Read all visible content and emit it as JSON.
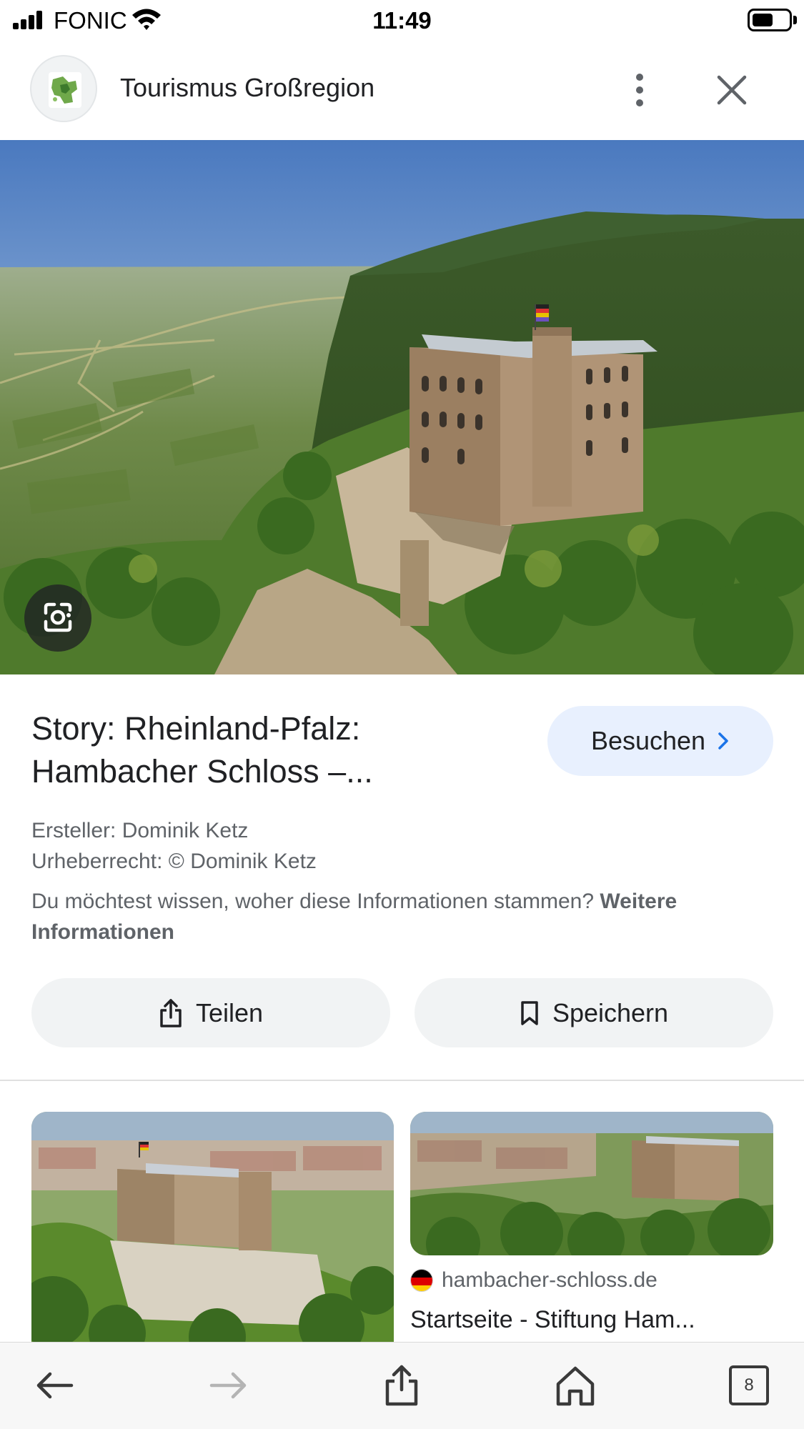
{
  "status_bar": {
    "carrier": "FONIC",
    "time": "11:49",
    "signal_icon": "cellular-signal-icon",
    "wifi_icon": "wifi-icon",
    "battery_icon": "battery-icon",
    "battery_level": 0.55
  },
  "header": {
    "title": "Tourismus Großregion",
    "logo": "site-logo",
    "more_icon": "more-vert-icon",
    "close_icon": "close-icon"
  },
  "hero": {
    "image": "aerial-view-castle-vineyards",
    "lens_icon": "google-lens-icon"
  },
  "story": {
    "title_line1": "Story: Rheinland-Pfalz:",
    "title_line2": "Hambacher Schloss –...",
    "visit_label": "Besuchen",
    "visit_icon": "chevron-right-icon",
    "creator": "Ersteller: Dominik Ketz",
    "copyright": "Urheberrecht: © Dominik Ketz",
    "info_text": "Du möchtest wissen, woher diese Informationen stammen? ",
    "info_link": "Weitere Informationen"
  },
  "actions": {
    "share_label": "Teilen",
    "share_icon": "share-icon",
    "save_label": "Speichern",
    "save_icon": "bookmark-icon"
  },
  "related": {
    "source": "hambacher-schloss.de",
    "source_icon": "german-flag-icon",
    "title": "Startseite - Stiftung Ham..."
  },
  "toolbar": {
    "back_icon": "arrow-back-icon",
    "forward_icon": "arrow-forward-icon",
    "share_icon": "share-icon",
    "home_icon": "home-icon",
    "tabs_count": "8"
  },
  "colors": {
    "accent_bg": "#e8f0fe",
    "pill_bg": "#f1f3f4",
    "text": "#202124",
    "secondary": "#5f6368"
  }
}
